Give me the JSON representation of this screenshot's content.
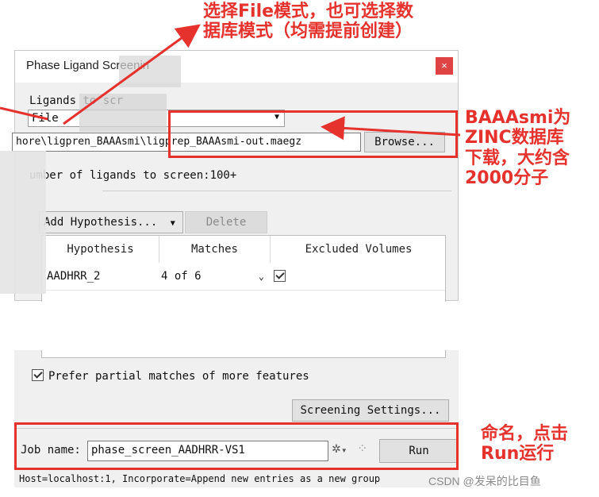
{
  "dialog": {
    "title": "Phase Ligand Screenin",
    "close_glyph": "×",
    "ligands_label": "Ligands to scr",
    "source_value": "File",
    "file_path": "hore\\ligpren_BAAAsmi\\ligprep_BAAAsmi-out.maegz",
    "browse_label": "Browse...",
    "ligand_count_text": "umber of ligands to screen:100+",
    "add_hypothesis_label": "Add Hypothesis...",
    "delete_label": "Delete",
    "table": {
      "headers": [
        "Hypothesis",
        "Matches",
        "Excluded Volumes"
      ],
      "rows": [
        {
          "hypothesis": "AADHRR_2",
          "matches": "4 of 6",
          "excluded": true
        }
      ]
    },
    "prefer_partial_label": "Prefer partial matches of more features",
    "screening_settings_label": "Screening Settings...",
    "job_name_label": "Job name:",
    "job_name_value": "phase_screen_AADHRR-VS1",
    "run_label": "Run",
    "status_text": "Host=localhost:1, Incorporate=Append new entries as a new group"
  },
  "annotations": {
    "top": [
      "选择File模式，也可选择数",
      "据库模式（均需提前创建）"
    ],
    "right": [
      "BAAAsmi为",
      "ZINC数据库",
      "下载，大约含",
      "2000分子"
    ],
    "bottom": [
      "命名，点击",
      "Run运行"
    ]
  },
  "watermark": "CSDN @发呆的比目鱼",
  "colors": {
    "annotation": "#e5322d",
    "close_button": "#e04343",
    "dialog_bg": "#f0f0f0"
  }
}
